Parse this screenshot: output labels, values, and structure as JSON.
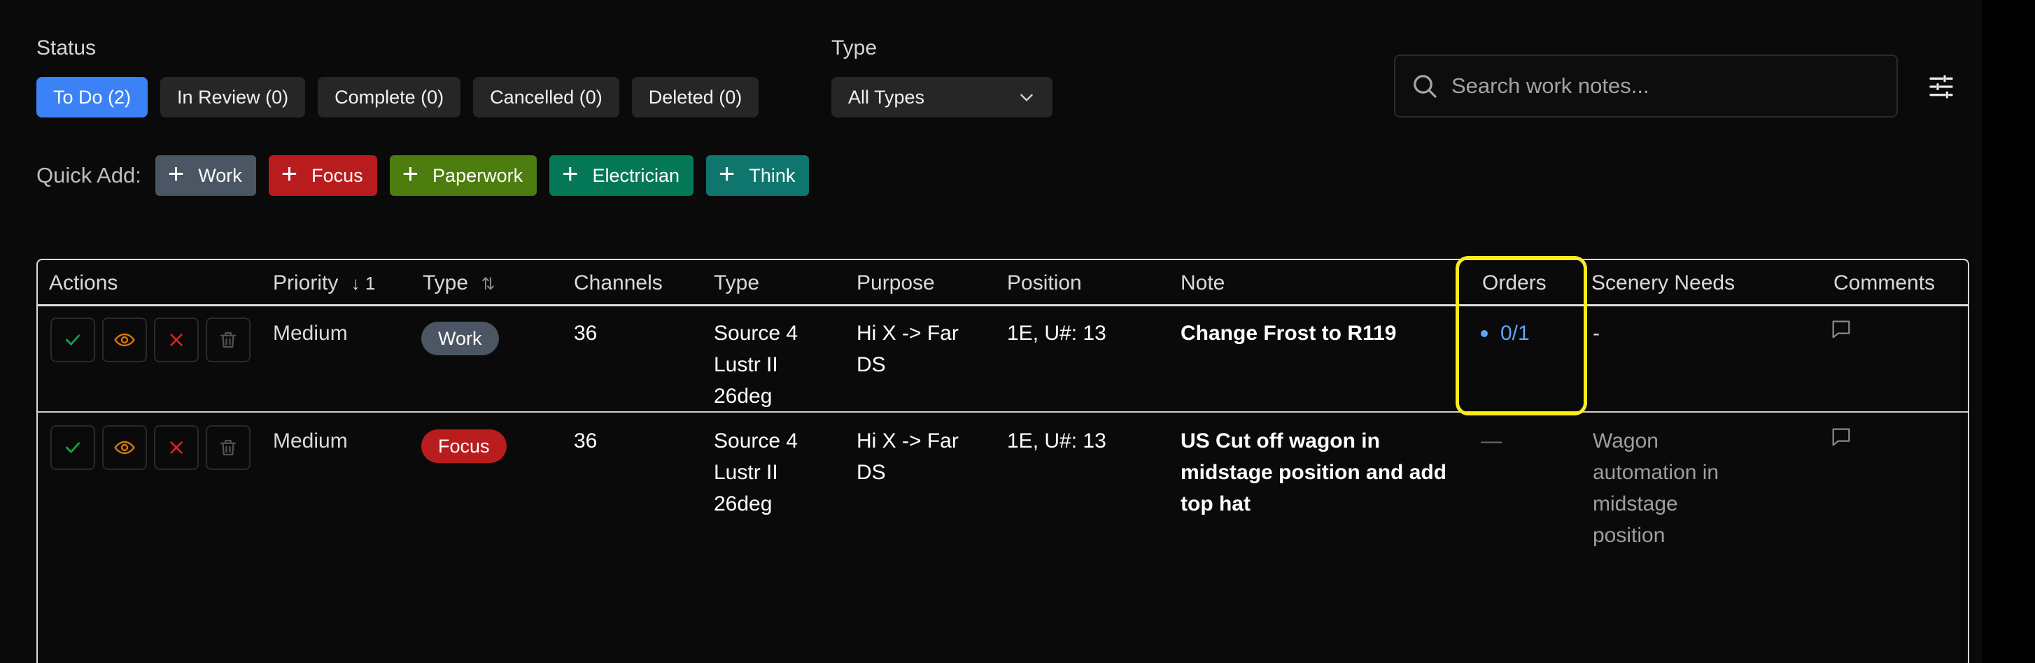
{
  "filters": {
    "status_label": "Status",
    "type_label": "Type",
    "status_pills": [
      {
        "label": "To Do (2)",
        "active": true
      },
      {
        "label": "In Review (0)",
        "active": false
      },
      {
        "label": "Complete (0)",
        "active": false
      },
      {
        "label": "Cancelled (0)",
        "active": false
      },
      {
        "label": "Deleted (0)",
        "active": false
      }
    ],
    "type_select": "All Types"
  },
  "search": {
    "placeholder": "Search work notes..."
  },
  "quick_add": {
    "label": "Quick Add:",
    "items": [
      {
        "label": "Work",
        "color": "#4b5563"
      },
      {
        "label": "Focus",
        "color": "#b91c1c"
      },
      {
        "label": "Paperwork",
        "color": "#4d7c0f"
      },
      {
        "label": "Electrician",
        "color": "#047857"
      },
      {
        "label": "Think",
        "color": "#0f766e"
      }
    ]
  },
  "table": {
    "headers": {
      "actions": "Actions",
      "priority": "Priority",
      "priority_sort": "↓ 1",
      "type": "Type",
      "type_sort": "⇅",
      "channels": "Channels",
      "fixture_type": "Type",
      "purpose": "Purpose",
      "position": "Position",
      "note": "Note",
      "orders": "Orders",
      "scenery": "Scenery Needs",
      "comments": "Comments"
    },
    "rows": [
      {
        "priority": "Medium",
        "type_badge": "Work",
        "type_color": "#4b5563",
        "channels": "36",
        "fixture_type": [
          "Source 4",
          "Lustr II",
          "26deg"
        ],
        "purpose": [
          "Hi X -> Far",
          "DS"
        ],
        "position": "1E, U#: 13",
        "note": [
          "Change Frost to R119"
        ],
        "orders": "0/1",
        "scenery": [
          "-"
        ]
      },
      {
        "priority": "Medium",
        "type_badge": "Focus",
        "type_color": "#b91c1c",
        "channels": "36",
        "fixture_type": [
          "Source 4",
          "Lustr II",
          "26deg"
        ],
        "purpose": [
          "Hi X -> Far",
          "DS"
        ],
        "position": "1E, U#: 13",
        "note": [
          "US Cut off wagon in",
          "midstage position and add",
          "top hat"
        ],
        "orders": "—",
        "scenery": [
          "Wagon",
          "automation in",
          "midstage",
          "position"
        ]
      }
    ]
  },
  "colors": {
    "accent": "#3b82f6",
    "highlight": "#ffeb1a",
    "check": "#22c55e",
    "eye": "#d97706",
    "close": "#dc2626",
    "trash": "#525252"
  }
}
